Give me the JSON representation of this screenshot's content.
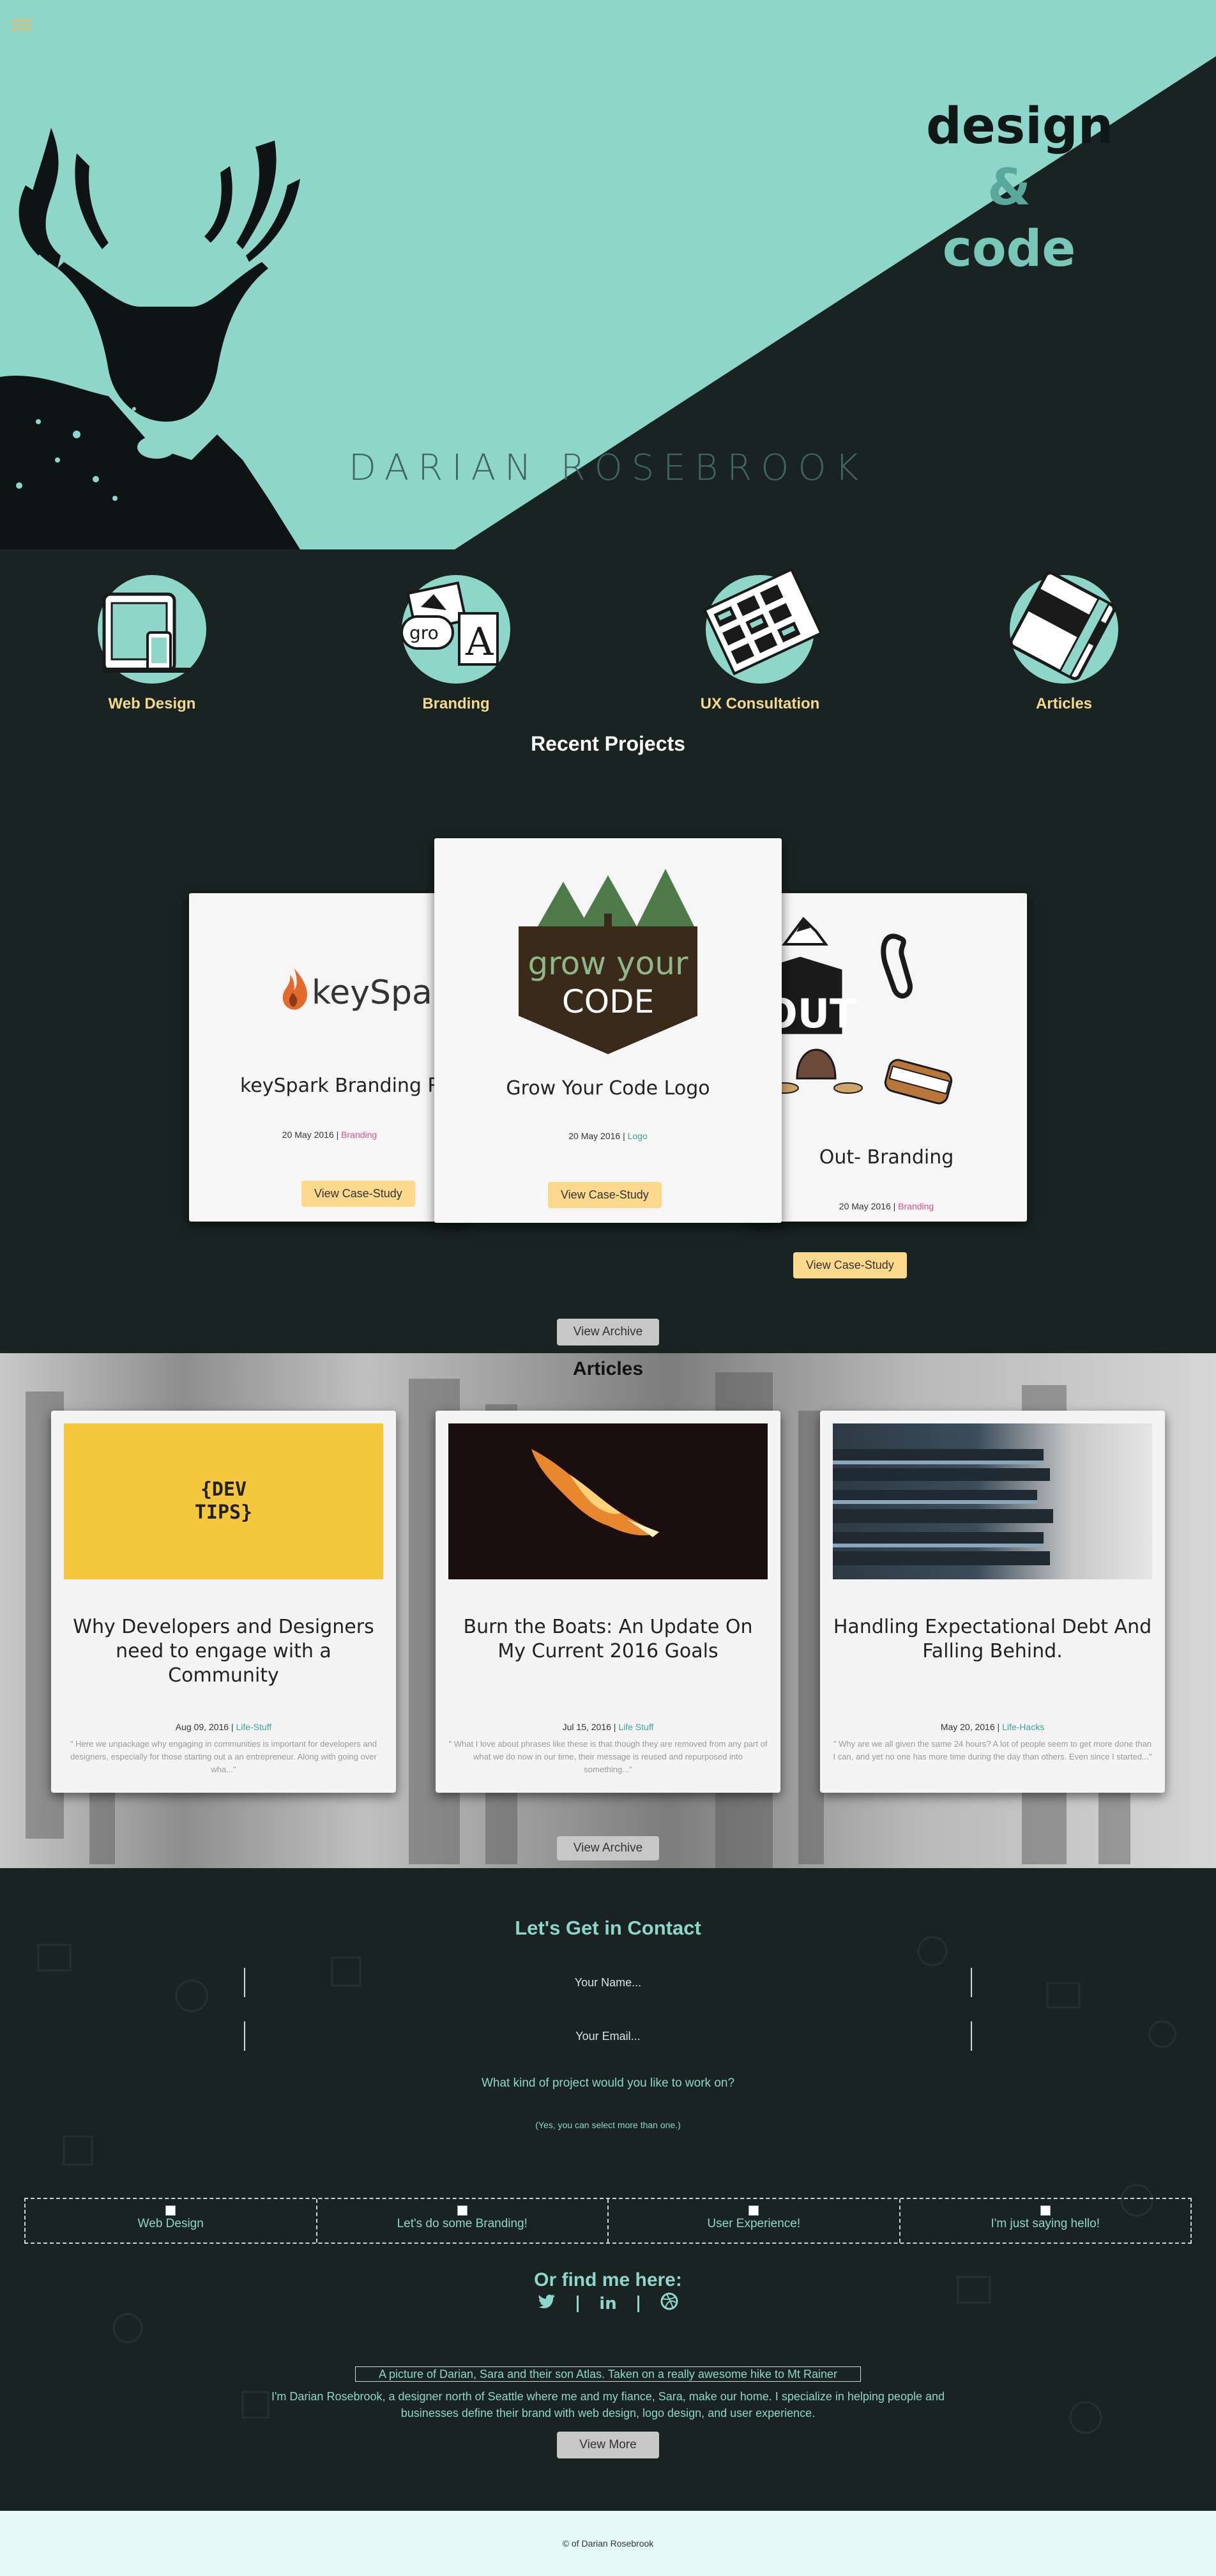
{
  "hero": {
    "tagline_line1": "design",
    "tagline_line2": "&",
    "tagline_line3": "code",
    "name": "DARIAN ROSEBROOK"
  },
  "services": [
    {
      "label": "Web Design",
      "icon": "devices-icon"
    },
    {
      "label": "Branding",
      "icon": "branding-icon"
    },
    {
      "label": "UX Consultation",
      "icon": "wireframes-icon"
    },
    {
      "label": "Articles",
      "icon": "notebook-icon"
    }
  ],
  "projects": {
    "title": "Recent Projects",
    "items": [
      {
        "image_text": "keySpark",
        "title": "keySpark Branding Redesign",
        "date": "20 May 2016",
        "category": "Branding",
        "button": "View Case-Study"
      },
      {
        "image_text_1": "grow your",
        "image_text_2": "CODE",
        "title": "Grow Your Code Logo",
        "date": "20 May 2016",
        "category": "Logo",
        "button": "View Case-Study"
      },
      {
        "image_text": "OUT",
        "title": "Out- Branding",
        "date": "20 May 2016",
        "category": "Branding",
        "button": "View Case-Study"
      }
    ],
    "archive_button": "View Archive"
  },
  "articles": {
    "title": "Articles",
    "items": [
      {
        "image_text": "{DEV TIPS}",
        "title": "Why Developers and Designers need to engage with a Community",
        "date": "Aug 09, 2016",
        "category": "Life-Stuff",
        "excerpt": "\" Here we unpackage why engaging in communities is important for developers and designers, especially for those starting out a an entrepreneur. Along with going over wha...\""
      },
      {
        "title": "Burn the Boats: An Update On My Current 2016 Goals",
        "date": "Jul 15, 2016",
        "category": "Life Stuff",
        "excerpt": "\" What I love about phrases like these is that though they are removed from any part of what we do now in our time, their message is reused and repurposed into something...\""
      },
      {
        "title": "Handling Expectational Debt And Falling Behind.",
        "date": "May 20, 2016",
        "category": "Life-Hacks",
        "excerpt": "\" Why are we all given the same 24 hours? A lot of people seem to get more done than I can, and yet no one has more time during the day than others. Even since I started...\""
      }
    ],
    "archive_button": "View Archive"
  },
  "contact": {
    "title": "Let's Get in Contact",
    "name_placeholder": "Your Name...",
    "email_placeholder": "Your Email...",
    "question": "What kind of project would you like to work on?",
    "hint": "(Yes, you can select more than one.)",
    "choices": [
      "Web Design",
      "Let's do some Branding!",
      "User Experience!",
      "I'm just saying hello!"
    ],
    "find_me": "Or find me here:",
    "socials": [
      "twitter-icon",
      "linkedin-icon",
      "dribbble-icon"
    ],
    "about_img_alt": "A picture of Darian, Sara and their son Atlas. Taken on a really awesome hike to Mt Rainer",
    "about_text": "I'm Darian Rosebrook, a designer north of Seattle where me and my fiance, Sara, make our home. I specialize in helping people and businesses define their brand with web design, logo design, and user experience.",
    "view_more": "View More"
  },
  "footer": {
    "text": "© of Darian Rosebrook"
  },
  "colors": {
    "accent": "#8ed6ca",
    "dark": "#182322",
    "button": "#fcd98d",
    "pink": "#e7507a"
  }
}
